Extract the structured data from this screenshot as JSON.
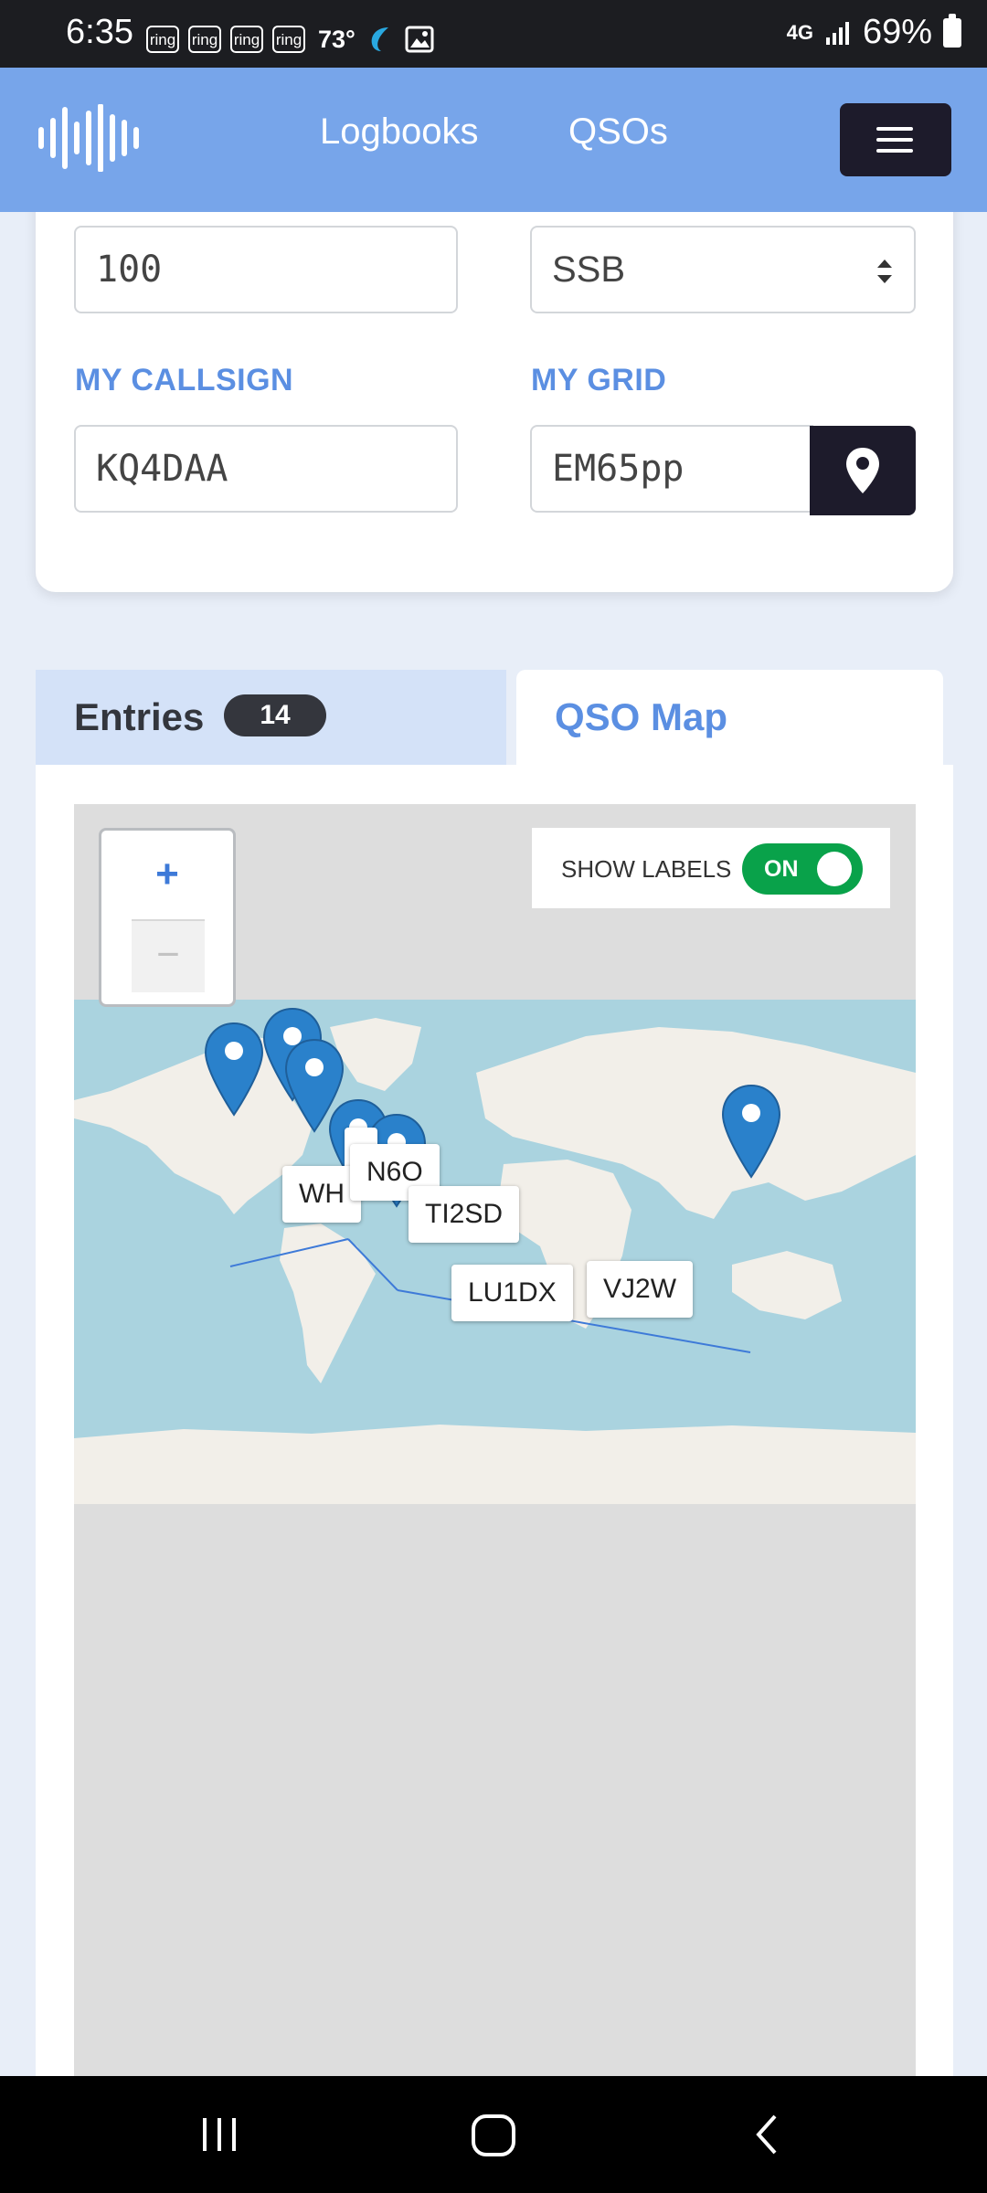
{
  "status_bar": {
    "time": "6:35",
    "notification_icons": [
      "ring",
      "ring",
      "ring",
      "ring"
    ],
    "temperature": "73°",
    "network": "4G",
    "battery": "69%"
  },
  "navbar": {
    "links": [
      "Logbooks",
      "QSOs"
    ],
    "brand_color": "#77a5ea"
  },
  "form": {
    "power_value": "100",
    "mode_value": "SSB",
    "my_callsign_label": "MY CALLSIGN",
    "my_callsign_value": "KQ4DAA",
    "my_grid_label": "MY GRID",
    "my_grid_value": "EM65pp"
  },
  "tabs": {
    "entries_label": "Entries",
    "entries_count": "14",
    "map_label": "QSO Map"
  },
  "map": {
    "zoom_in_label": "+",
    "zoom_out_label": "−",
    "show_labels_label": "SHOW LABELS",
    "show_labels_state": "ON",
    "station_labels": [
      "WH",
      "N6O",
      "TI2SD",
      "LU1DX",
      "VJ2W"
    ]
  }
}
